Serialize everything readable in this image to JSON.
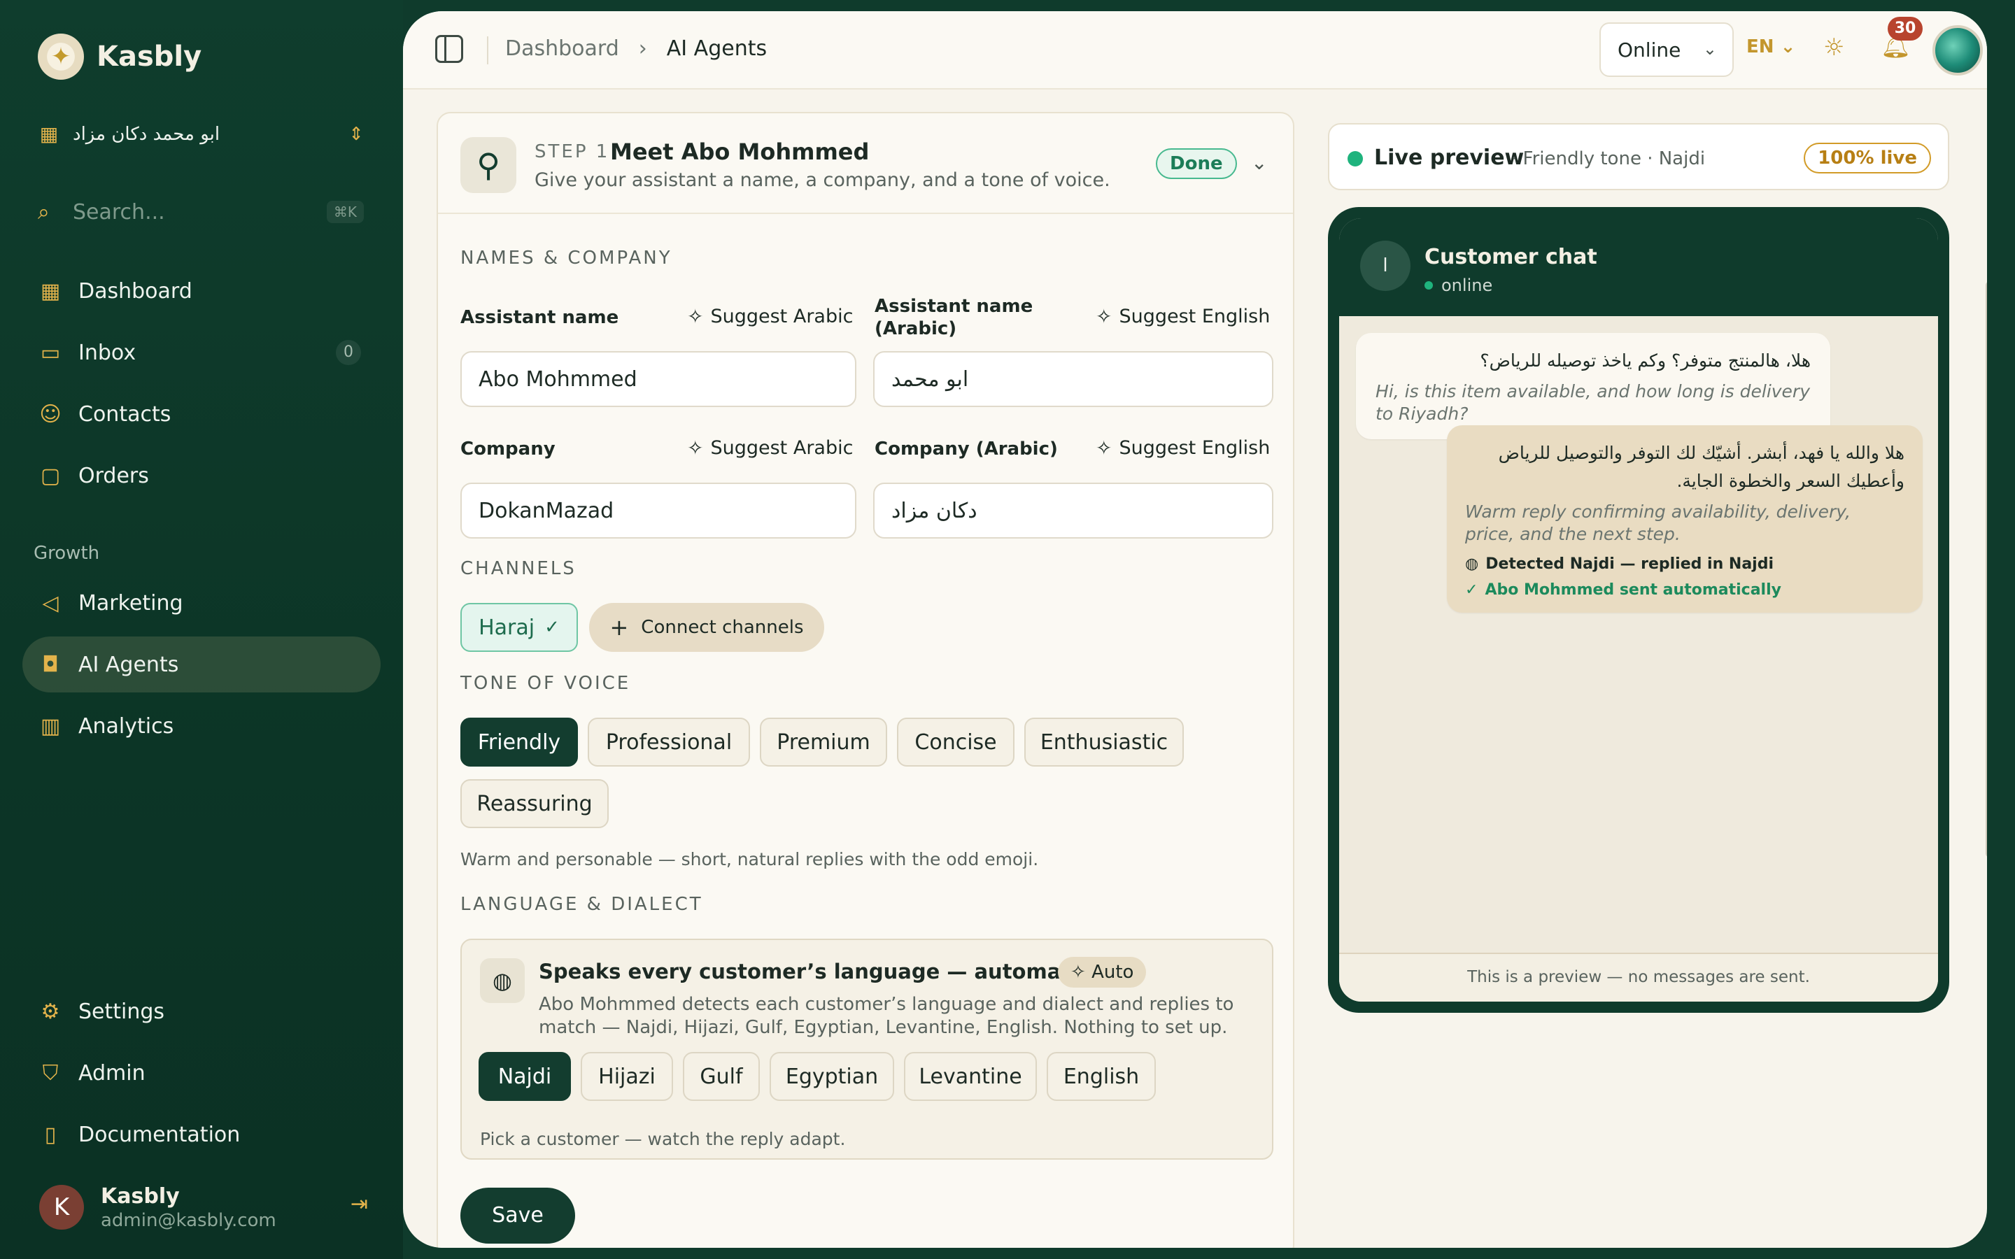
{
  "sidebar": {
    "brand": "Kasbly",
    "workspace": "ابو محمد دكان مزاد",
    "search_placeholder": "Search...",
    "search_shortcut": "⌘K",
    "items": [
      {
        "label": "Dashboard",
        "icon": "grid-icon"
      },
      {
        "label": "Inbox",
        "icon": "inbox-icon",
        "count": "0"
      },
      {
        "label": "Contacts",
        "icon": "users-icon"
      },
      {
        "label": "Orders",
        "icon": "shopping-bag-icon"
      }
    ],
    "section_growth": "Growth",
    "growth_items": [
      {
        "label": "Marketing",
        "icon": "megaphone-icon"
      },
      {
        "label": "AI Agents",
        "icon": "bot-icon",
        "active": true
      },
      {
        "label": "Analytics",
        "icon": "bar-chart-icon"
      }
    ],
    "bottom_items": [
      {
        "label": "Settings",
        "icon": "gear-icon"
      },
      {
        "label": "Admin",
        "icon": "shield-icon"
      },
      {
        "label": "Documentation",
        "icon": "book-icon"
      }
    ],
    "user": {
      "initial": "K",
      "name": "Kasbly",
      "email": "admin@kasbly.com"
    }
  },
  "topbar": {
    "breadcrumb": [
      "Dashboard",
      "AI Agents"
    ],
    "status": "Online",
    "language": "EN",
    "notifications": "30"
  },
  "step": {
    "label": "STEP 1",
    "title": "Meet Abo Mohmmed",
    "subtitle": "Give your assistant a name, a company, and a tone of voice.",
    "badge": "Done"
  },
  "names": {
    "section": "NAMES & COMPANY",
    "assistant_label": "Assistant name",
    "assistant_value": "Abo Mohmmed",
    "assistant_ar_label": "Assistant name (Arabic)",
    "assistant_ar_value": "ابو محمد",
    "company_label": "Company",
    "company_value": "DokanMazad",
    "company_ar_label": "Company (Arabic)",
    "company_ar_value": "دكان مزاد",
    "suggest_arabic": "Suggest Arabic",
    "suggest_english": "Suggest English"
  },
  "channels": {
    "section": "CHANNELS",
    "connected": "Haraj",
    "connect_label": "Connect channels"
  },
  "tone": {
    "section": "TONE OF VOICE",
    "options": [
      "Friendly",
      "Professional",
      "Premium",
      "Concise",
      "Enthusiastic",
      "Reassuring"
    ],
    "selected": "Friendly",
    "description": "Warm and personable — short, natural replies with the odd emoji."
  },
  "language": {
    "section": "LANGUAGE & DIALECT",
    "title": "Speaks every customer’s language — automatically",
    "auto_badge": "Auto",
    "description": "Abo Mohmmed detects each customer’s language and dialect and replies to match — Najdi, Hijazi, Gulf, Egyptian, Levantine, English. Nothing to set up.",
    "dialects": [
      "Najdi",
      "Hijazi",
      "Gulf",
      "Egyptian",
      "Levantine",
      "English"
    ],
    "selected": "Najdi",
    "hint": "Pick a customer — watch the reply adapt."
  },
  "save_label": "Save",
  "preview": {
    "title": "Live preview",
    "subtitle": "· Friendly tone · Najdi",
    "badge": "100% live",
    "chat_title": "Customer chat",
    "chat_status": "online",
    "chat_avatar": "ا",
    "incoming_ar": "هلا، هالمنتج متوفر؟ وكم ياخذ توصيله للرياض؟",
    "incoming_en": "Hi, is this item available, and how long is delivery to Riyadh?",
    "reply_ar": "هلا والله يا فهد، أبشر. أشيّك لك التوفر والتوصيل للرياض وأعطيك السعر والخطوة الجاية.",
    "reply_en": "Warm reply confirming availability, delivery, price, and the next step.",
    "detected": "Detected Najdi — replied in Najdi",
    "sent": "Abo Mohmmed sent automatically",
    "footer": "This is a preview — no messages are sent."
  },
  "colors": {
    "sidebar": "#0f3d2d",
    "accent": "#e3b34b",
    "primary": "#133d2f",
    "success": "#1fb37d"
  }
}
